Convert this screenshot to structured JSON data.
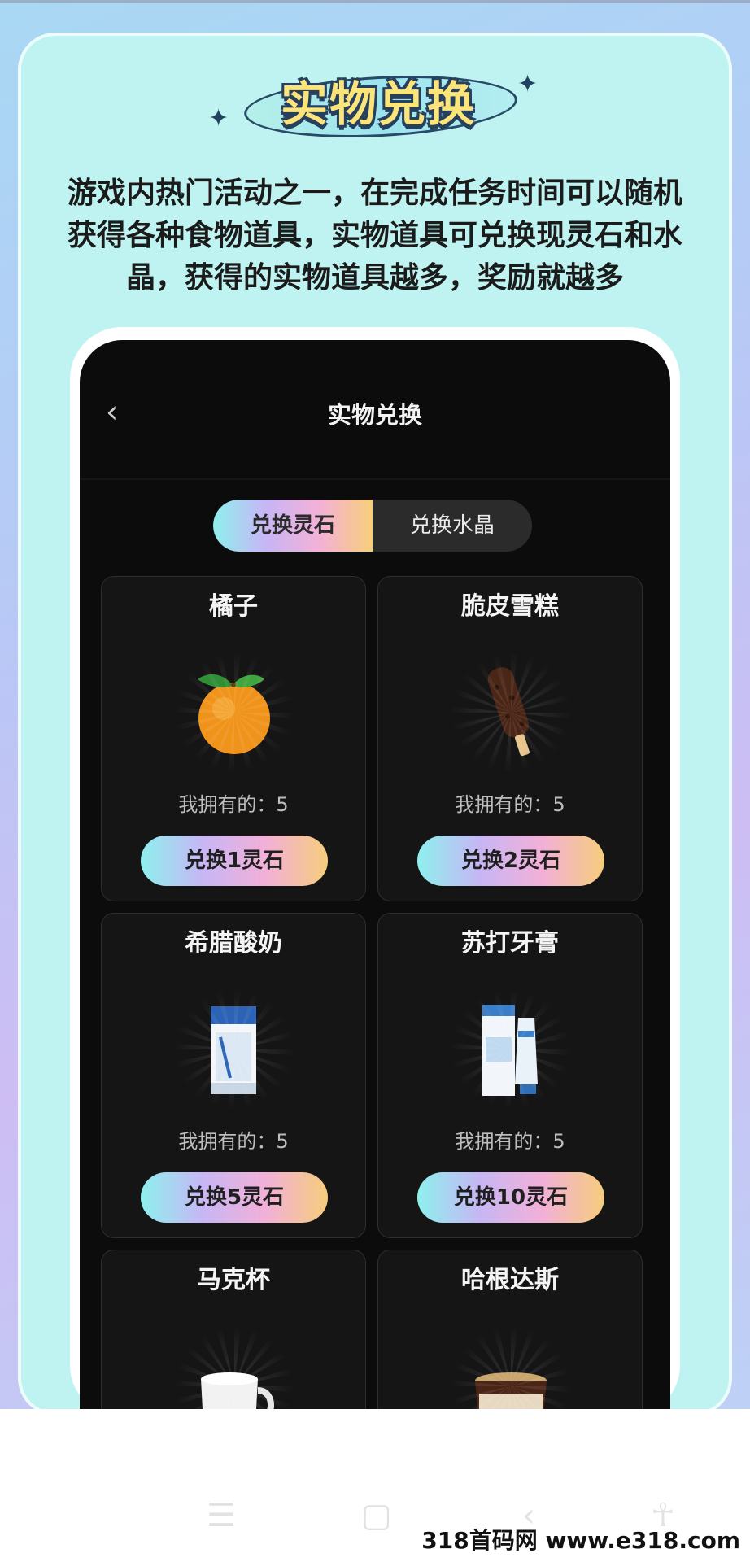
{
  "banner": {
    "title": "实物兑换"
  },
  "description": {
    "line1": "游戏内热门活动之一，在完成任务时间可以随机",
    "line2": "获得各种食物道具，实物道具可兑换现灵石和水",
    "line3": "晶，获得的实物道具越多，奖励就越多"
  },
  "screen": {
    "nav_title": "实物兑换",
    "back_symbol": "‹",
    "tabs": [
      "兑换灵石",
      "兑换水晶"
    ],
    "items": [
      {
        "name": "橘子",
        "owned": "我拥有的：5",
        "button": "兑换1灵石",
        "icon": "orange-icon"
      },
      {
        "name": "脆皮雪糕",
        "owned": "我拥有的：5",
        "button": "兑换2灵石",
        "icon": "ice-cream-bar-icon"
      },
      {
        "name": "希腊酸奶",
        "owned": "我拥有的：5",
        "button": "兑换5灵石",
        "icon": "yogurt-carton-icon"
      },
      {
        "name": "苏打牙膏",
        "owned": "我拥有的：5",
        "button": "兑换10灵石",
        "icon": "toothpaste-icon"
      },
      {
        "name": "马克杯",
        "icon": "mug-icon"
      },
      {
        "name": "哈根达斯",
        "icon": "ice-cream-tub-icon"
      }
    ]
  },
  "watermark": "318首码网  www.e318.com"
}
